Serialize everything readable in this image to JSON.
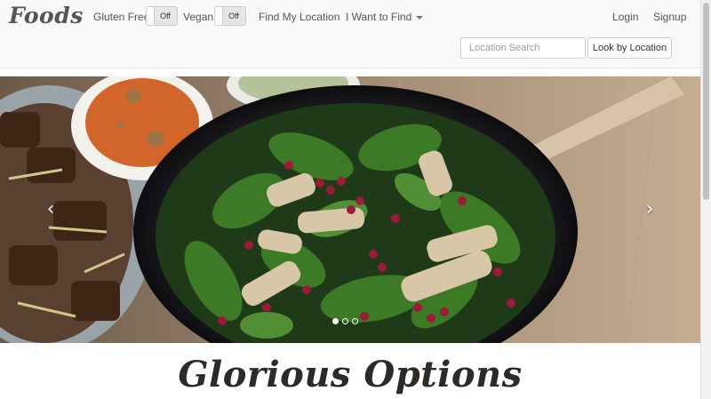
{
  "brand": "Foods",
  "filters": {
    "gluten_free_label": "Gluten Free:",
    "gluten_free_state": "Off",
    "vegan_label": "Vegan:",
    "vegan_state": "Off"
  },
  "nav": {
    "find_location": "Find My Location",
    "want_to_find": "I Want to Find",
    "login": "Login",
    "signup": "Signup"
  },
  "search": {
    "placeholder": "Location Search",
    "button": "Look by Location"
  },
  "carousel": {
    "prev_icon": "‹",
    "next_icon": "›",
    "slide_count": 3,
    "active_slide": 1
  },
  "headline": "Glorious Options"
}
